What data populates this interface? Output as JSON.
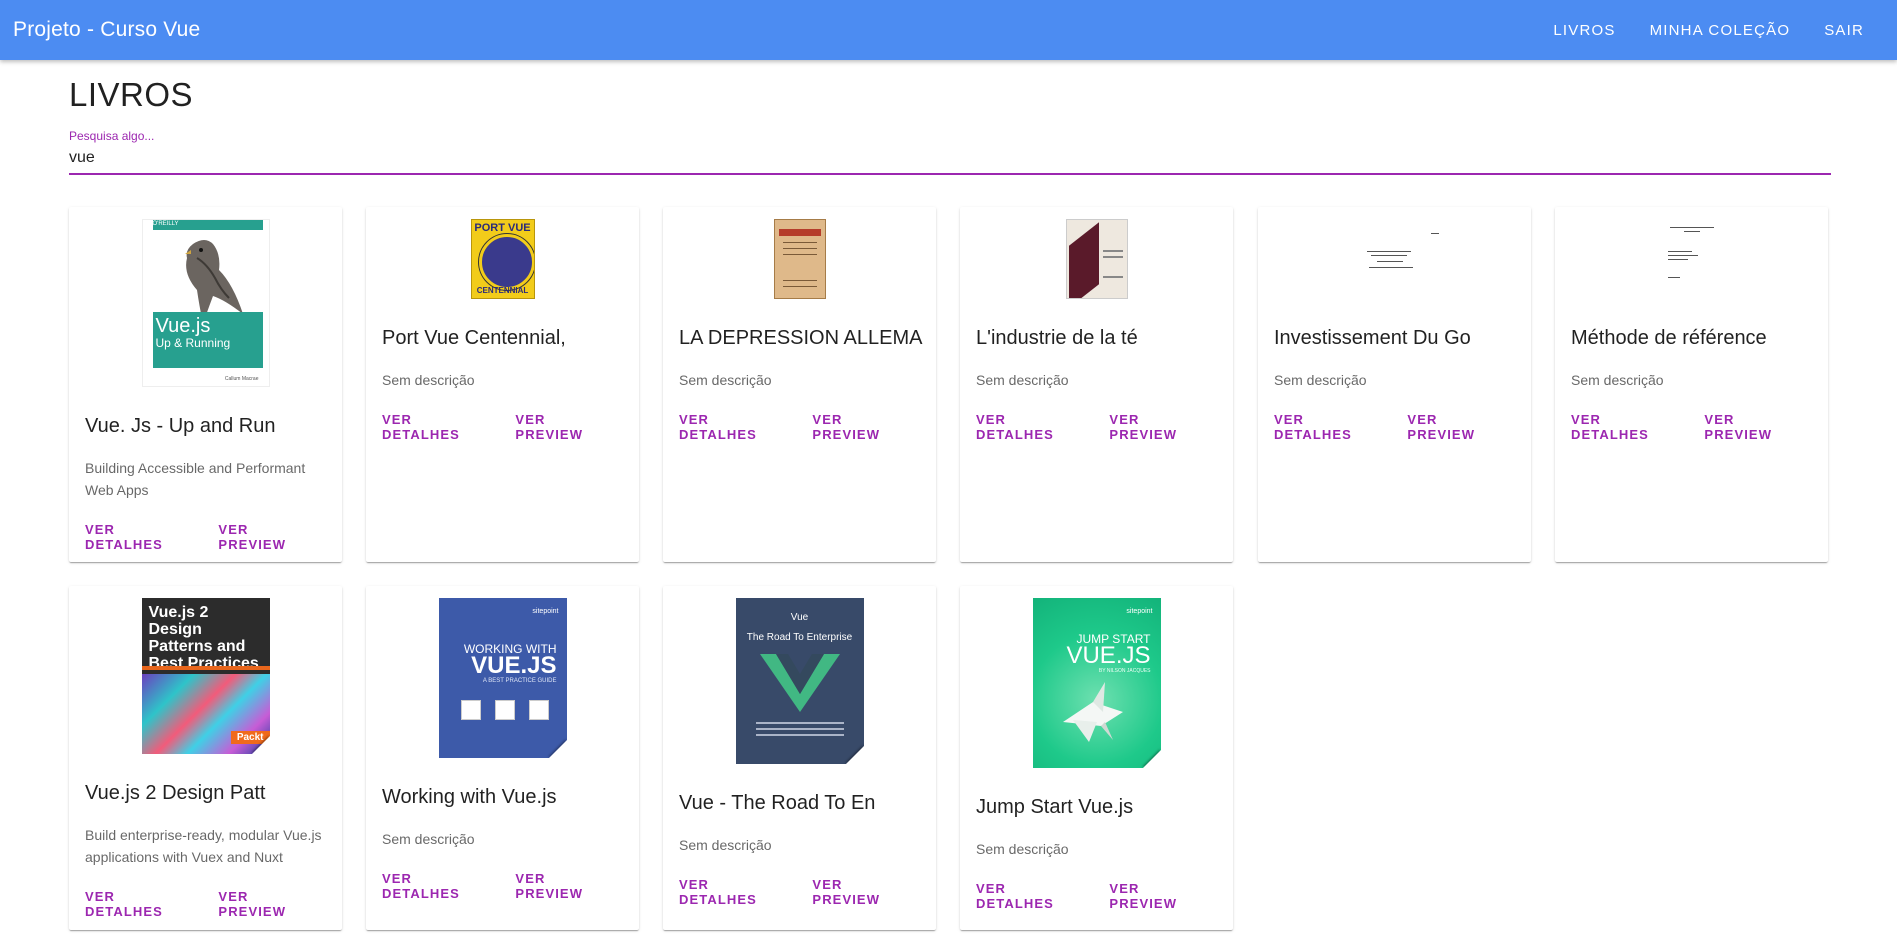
{
  "app": {
    "title": "Projeto - Curso Vue",
    "nav": [
      {
        "label": "LIVROS"
      },
      {
        "label": "MINHA COLEÇÃO"
      },
      {
        "label": "SAIR"
      }
    ]
  },
  "page": {
    "title": "LIVROS"
  },
  "search": {
    "label": "Pesquisa algo...",
    "value": "vue"
  },
  "colors": {
    "appbar": "#4c8cf2",
    "accent": "#9c27b0"
  },
  "books": [
    {
      "title": "Vue. Js - Up and Run",
      "description": "Building Accessible and Performant Web Apps",
      "details_label": "VER DETALHES",
      "preview_label": "VER PREVIEW",
      "cover": {
        "publisher": "O'REILLY",
        "title": "Vue.js",
        "subtitle": "Up & Running",
        "author": "Callum Macrae"
      }
    },
    {
      "title": "Port Vue Centennial,",
      "description": "Sem descrição",
      "details_label": "VER DETALHES",
      "preview_label": "VER PREVIEW",
      "cover": {
        "title": "PORT VUE",
        "subtitle": "CENTENNIAL"
      }
    },
    {
      "title": "LA DEPRESSION ALLEMA",
      "description": "Sem descrição",
      "details_label": "VER DETALHES",
      "preview_label": "VER PREVIEW"
    },
    {
      "title": "L'industrie de la té",
      "description": "Sem descrição",
      "details_label": "VER DETALHES",
      "preview_label": "VER PREVIEW"
    },
    {
      "title": "Investissement Du Go",
      "description": "Sem descrição",
      "details_label": "VER DETALHES",
      "preview_label": "VER PREVIEW"
    },
    {
      "title": "Méthode de référence",
      "description": "Sem descrição",
      "details_label": "VER DETALHES",
      "preview_label": "VER PREVIEW"
    },
    {
      "title": "Vue.js 2 Design Patt",
      "description": "Build enterprise-ready, modular Vue.js applications with Vuex and Nuxt",
      "details_label": "VER DETALHES",
      "preview_label": "VER PREVIEW",
      "cover": {
        "title": "Vue.js 2 Design Patterns and Best Practices",
        "publisher": "Packt"
      }
    },
    {
      "title": "Working with Vue.js",
      "description": "Sem descrição",
      "details_label": "VER DETALHES",
      "preview_label": "VER PREVIEW",
      "cover": {
        "publisher": "sitepoint",
        "line1": "WORKING WITH",
        "line2": "VUE.JS",
        "line3": "A BEST PRACTICE GUIDE"
      }
    },
    {
      "title": "Vue - The Road To En",
      "description": "Sem descrição",
      "details_label": "VER DETALHES",
      "preview_label": "VER PREVIEW",
      "cover": {
        "line1": "Vue",
        "line2": "The Road To Enterprise"
      }
    },
    {
      "title": "Jump Start Vue.js",
      "description": "Sem descrição",
      "details_label": "VER DETALHES",
      "preview_label": "VER PREVIEW",
      "cover": {
        "publisher": "sitepoint",
        "line1": "JUMP START",
        "line2": "VUE.JS",
        "line3": "BY NILSON JACQUES"
      }
    }
  ]
}
